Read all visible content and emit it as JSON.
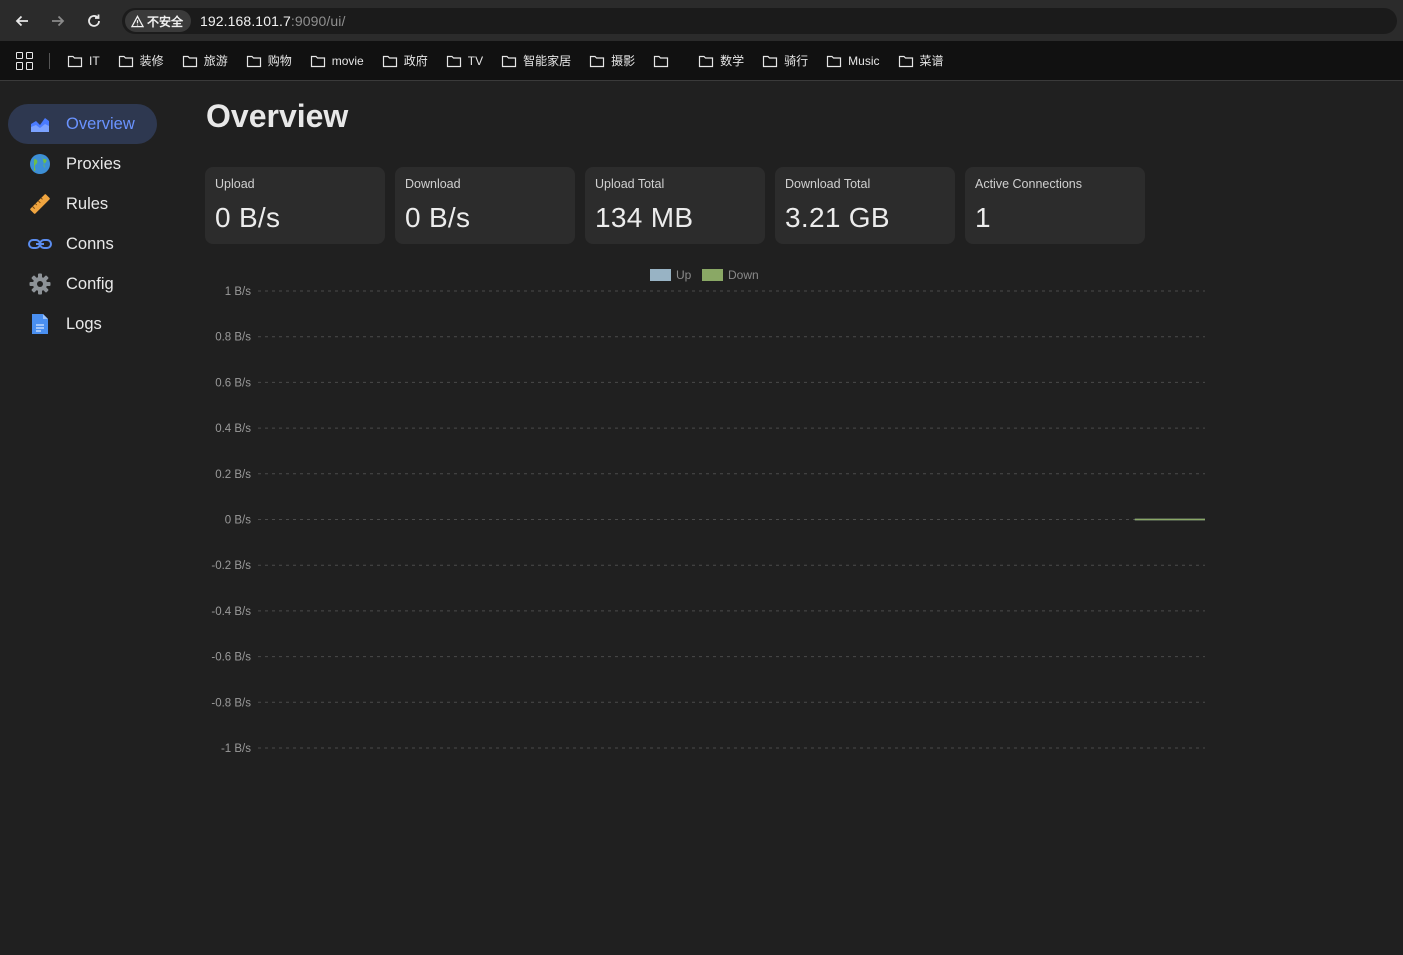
{
  "browser": {
    "security_chip": "不安全",
    "url_host": "192.168.101.7",
    "url_rest": ":9090/ui/",
    "bookmarks": [
      "IT",
      "装修",
      "旅游",
      "购物",
      "movie",
      "政府",
      "TV",
      "智能家居",
      "摄影",
      "",
      "数学",
      "骑行",
      "Music",
      "菜谱"
    ]
  },
  "sidebar": {
    "items": [
      {
        "label": "Overview",
        "icon": "area-chart-icon",
        "active": true
      },
      {
        "label": "Proxies",
        "icon": "globe-icon",
        "active": false
      },
      {
        "label": "Rules",
        "icon": "ruler-icon",
        "active": false
      },
      {
        "label": "Conns",
        "icon": "link-icon",
        "active": false
      },
      {
        "label": "Config",
        "icon": "gear-icon",
        "active": false
      },
      {
        "label": "Logs",
        "icon": "document-icon",
        "active": false
      }
    ]
  },
  "main": {
    "title": "Overview",
    "cards": [
      {
        "label": "Upload",
        "value": "0 B/s"
      },
      {
        "label": "Download",
        "value": "0 B/s"
      },
      {
        "label": "Upload Total",
        "value": "134 MB"
      },
      {
        "label": "Download Total",
        "value": "3.21 GB"
      },
      {
        "label": "Active Connections",
        "value": "1"
      }
    ]
  },
  "colors": {
    "up_series": "#98b3c4",
    "down_series": "#8aa865",
    "accent": "#6a93ff",
    "active_nav_bg": "#2e3850"
  },
  "chart_data": {
    "type": "line",
    "title": "",
    "xlabel": "",
    "ylabel": "",
    "legend": "top-center",
    "grid": true,
    "ylim": [
      -1,
      1
    ],
    "yticks": [
      "1 B/s",
      "0.8 B/s",
      "0.6 B/s",
      "0.4 B/s",
      "0.2 B/s",
      "0 B/s",
      "-0.2 B/s",
      "-0.4 B/s",
      "-0.6 B/s",
      "-0.8 B/s",
      "-1 B/s"
    ],
    "series": [
      {
        "name": "Up",
        "values": [
          0,
          0,
          0,
          0,
          0,
          0,
          0
        ]
      },
      {
        "name": "Down",
        "values": [
          0,
          0,
          0,
          0,
          0,
          0,
          0
        ]
      }
    ]
  }
}
